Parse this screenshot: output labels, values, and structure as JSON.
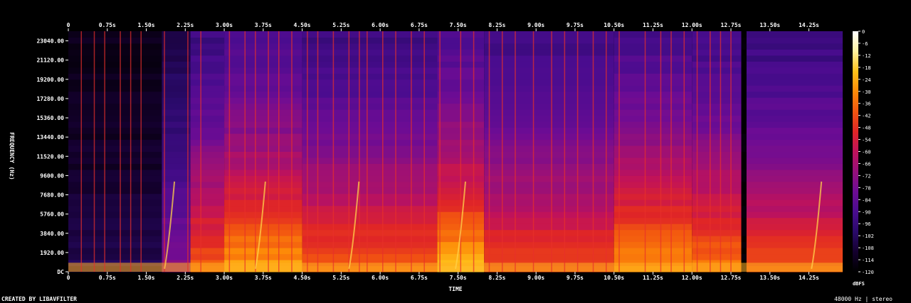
{
  "chart_data": {
    "type": "heatmap",
    "title": "",
    "xlabel": "TIME",
    "ylabel": "FREQUENCY (Hz)",
    "colorbar_label": "dBFS",
    "x_range": [
      0,
      14.9
    ],
    "y_range": [
      0,
      24000
    ],
    "color_range": [
      -120,
      0
    ],
    "x_ticks": [
      "0",
      "0.75s",
      "1.50s",
      "2.25s",
      "3.00s",
      "3.75s",
      "4.50s",
      "5.25s",
      "6.00s",
      "6.75s",
      "7.50s",
      "8.25s",
      "9.00s",
      "9.75s",
      "10.50s",
      "11.25s",
      "12.00s",
      "12.75s",
      "13.50s",
      "14.25s"
    ],
    "x_tick_values": [
      0,
      0.75,
      1.5,
      2.25,
      3.0,
      3.75,
      4.5,
      5.25,
      6.0,
      6.75,
      7.5,
      8.25,
      9.0,
      9.75,
      10.5,
      11.25,
      12.0,
      12.75,
      13.5,
      14.25
    ],
    "y_ticks": [
      "DC",
      "1920.00",
      "3840.00",
      "5760.00",
      "7680.00",
      "9600.00",
      "11520.00",
      "13440.00",
      "15360.00",
      "17280.00",
      "19200.00",
      "21120.00",
      "23040.00"
    ],
    "y_tick_values": [
      0,
      1920,
      3840,
      5760,
      7680,
      9600,
      11520,
      13440,
      15360,
      17280,
      19200,
      21120,
      23040
    ],
    "colorbar_ticks": [
      "0",
      "-6",
      "-12",
      "-18",
      "-24",
      "-30",
      "-36",
      "-42",
      "-48",
      "-54",
      "-60",
      "-66",
      "-72",
      "-78",
      "-84",
      "-90",
      "-96",
      "-102",
      "-108",
      "-114",
      "-120"
    ],
    "colorbar_tick_values": [
      0,
      -6,
      -12,
      -18,
      -24,
      -30,
      -36,
      -42,
      -48,
      -54,
      -60,
      -66,
      -72,
      -78,
      -84,
      -90,
      -96,
      -102,
      -108,
      -114,
      -120
    ],
    "colormap": [
      "#000000",
      "#14002e",
      "#2a0a6a",
      "#4a0c8f",
      "#6d0c94",
      "#96107a",
      "#c0125a",
      "#e02626",
      "#f25610",
      "#fd8b08",
      "#ffc21a",
      "#fff2a0",
      "#ffffff"
    ],
    "segments": [
      {
        "start": 0,
        "end": 1.8,
        "level": 0.12
      },
      {
        "start": 1.8,
        "end": 2.35,
        "level": 0.35
      },
      {
        "start": 2.35,
        "end": 3.0,
        "level": 0.62
      },
      {
        "start": 3.0,
        "end": 4.5,
        "level": 0.72
      },
      {
        "start": 4.5,
        "end": 7.1,
        "level": 0.62
      },
      {
        "start": 7.1,
        "end": 8.0,
        "level": 0.75
      },
      {
        "start": 8.0,
        "end": 10.5,
        "level": 0.6
      },
      {
        "start": 10.5,
        "end": 12.0,
        "level": 0.7
      },
      {
        "start": 12.0,
        "end": 12.95,
        "level": 0.66
      },
      {
        "start": 12.95,
        "end": 13.05,
        "level": 0.0
      },
      {
        "start": 13.05,
        "end": 14.9,
        "level": 0.6
      }
    ],
    "transients": [
      0.25,
      0.5,
      0.7,
      1.0,
      1.2,
      1.4,
      1.85,
      2.3,
      2.55,
      3.1,
      3.4,
      3.6,
      3.85,
      4.05,
      4.3,
      4.6,
      4.8,
      5.1,
      5.4,
      5.6,
      5.75,
      6.05,
      6.3,
      6.6,
      6.85,
      7.15,
      7.55,
      7.8,
      8.1,
      8.35,
      8.6,
      8.95,
      9.3,
      9.55,
      9.8,
      10.1,
      10.35,
      10.6,
      11.1,
      11.4,
      11.6,
      11.85,
      12.1,
      12.35,
      12.55,
      12.75
    ],
    "chirps": [
      1.85,
      3.6,
      5.4,
      7.45,
      14.3
    ],
    "grid": false,
    "legend": "right"
  },
  "footer": {
    "left": "CREATED BY LIBAVFILTER",
    "right": "48000 Hz | stereo"
  }
}
